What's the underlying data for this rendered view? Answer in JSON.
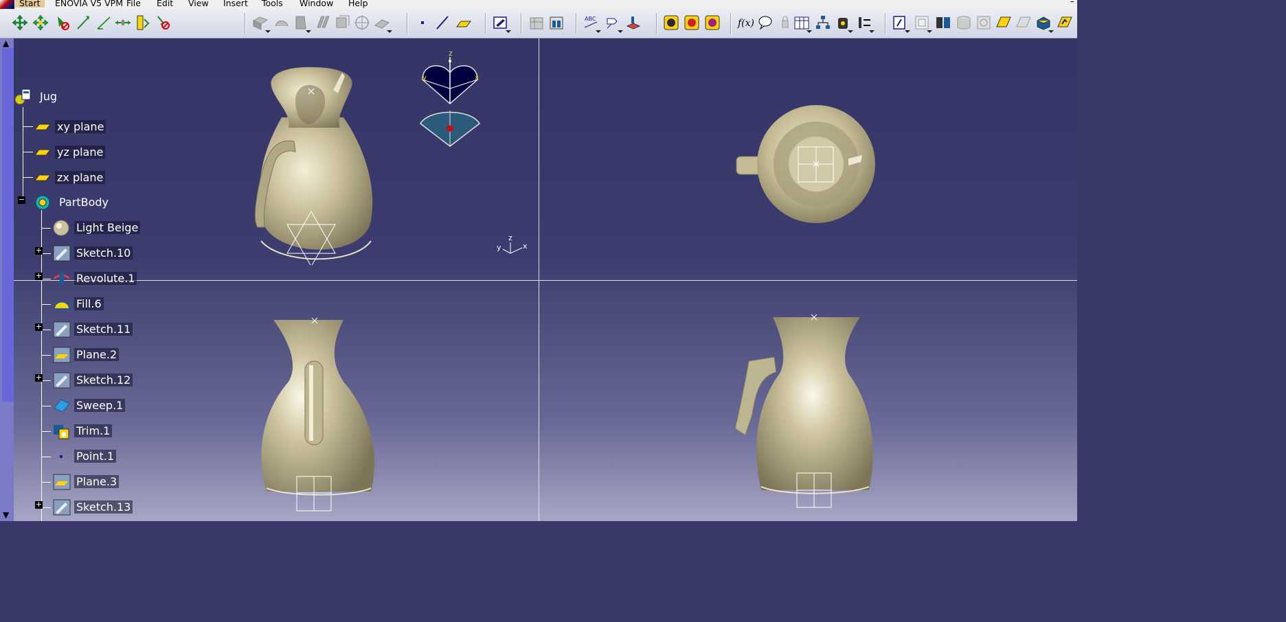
{
  "menu": {
    "start": "Start",
    "enovia": "ENOVIA V5 VPM",
    "file": "File",
    "edit": "Edit",
    "view": "View",
    "insert": "Insert",
    "tools": "Tools",
    "window": "Window",
    "help": "Help",
    "minimize": "–"
  },
  "tree": {
    "root": "Jug",
    "xy": "xy plane",
    "yz": "yz plane",
    "zx": "zx plane",
    "partbody": "PartBody",
    "items": [
      "Light Beige",
      "Sketch.10",
      "Revolute.1",
      "Fill.6",
      "Sketch.11",
      "Plane.2",
      "Sketch.12",
      "Sweep.1",
      "Trim.1",
      "Point.1",
      "Plane.3",
      "Sketch.13"
    ]
  },
  "compass": {
    "z": "z",
    "y": "y",
    "x": "x"
  },
  "axis": {
    "z": "z",
    "y": "y",
    "x": "x"
  },
  "colors": {
    "background_top": "#343466",
    "background_bottom": "#a6a6c4",
    "part": "#c8bf98",
    "menu_start": "#e8c896"
  }
}
